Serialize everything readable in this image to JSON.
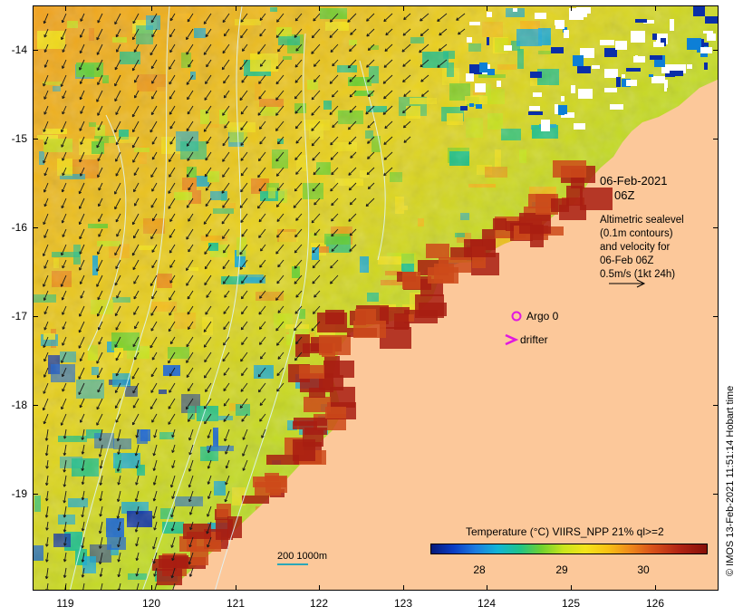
{
  "map": {
    "x_ticks": [
      "119",
      "120",
      "121",
      "122",
      "123",
      "124",
      "125",
      "126"
    ],
    "y_ticks": [
      "-14",
      "-15",
      "-16",
      "-17",
      "-18",
      "-19"
    ]
  },
  "annotations": {
    "date": "06-Feb-2021",
    "time": "06Z",
    "legend_lines": [
      "Altimetric sealevel",
      "(0.1m contours)",
      "and velocity for",
      "06-Feb 06Z",
      "0.5m/s (1kt 24h)"
    ],
    "argo_label": "Argo 0",
    "drifter_label": "drifter",
    "scale_label": "200  1000m"
  },
  "colorbar": {
    "title": "Temperature (°C) VIIRS_NPP 21% ql>=2",
    "ticks": [
      "28",
      "29",
      "30"
    ]
  },
  "credit": "© IMOS 13-Feb-2021 11:51:14 Hobart time",
  "colors": {
    "land": "#fcc89a",
    "marker": "#e018e0",
    "contour": "#dff7ff",
    "velocity": "#1a1a1a"
  }
}
